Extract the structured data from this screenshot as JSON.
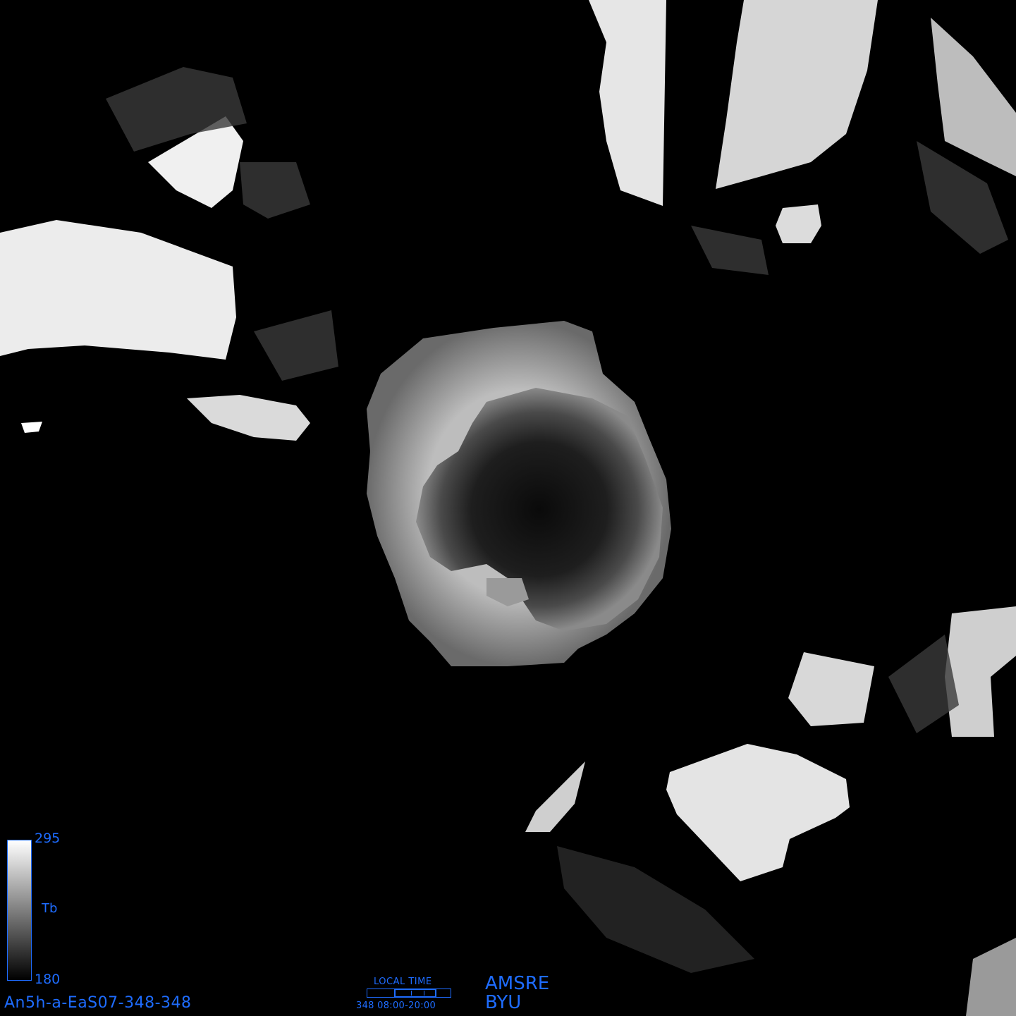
{
  "map": {
    "projection": "polar stereographic (south)",
    "colormap": "grayscale"
  },
  "colorbar": {
    "max": "295",
    "min": "180",
    "variable": "Tb"
  },
  "image_id": "An5h-a-EaS07-348-348",
  "local_time": {
    "title": "LOCAL TIME",
    "day": "348",
    "range": "08:00-20:00",
    "values_text": "348  08:00-20:00"
  },
  "credits": {
    "sensor": "AMSRE",
    "org": "BYU"
  },
  "colors": {
    "annotation": "#1e6cff",
    "background": "#000000"
  }
}
